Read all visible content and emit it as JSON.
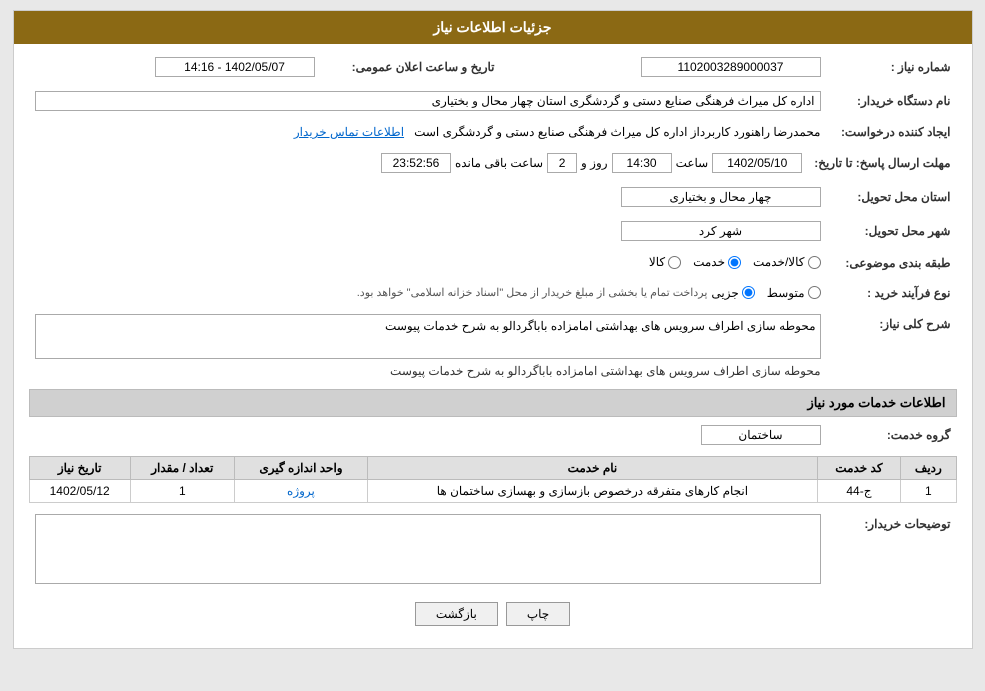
{
  "header": {
    "title": "جزئیات اطلاعات نیاز"
  },
  "fields": {
    "need_number_label": "شماره نیاز :",
    "need_number_value": "1102003289000037",
    "date_label": "تاریخ و ساعت اعلان عمومی:",
    "date_value": "1402/05/07 - 14:16",
    "buyer_org_label": "نام دستگاه خریدار:",
    "buyer_org_value": "اداره کل میراث فرهنگی  صنایع دستی و گردشگری استان چهار محال و بختیاری",
    "creator_label": "ایجاد کننده درخواست:",
    "creator_value": "محمدرضا راهنورد کاربرداز اداره کل میراث فرهنگی  صنایع دستی و گردشگری است",
    "creator_link": "اطلاعات تماس خریدار",
    "response_deadline_label": "مهلت ارسال پاسخ: تا تاریخ:",
    "response_date": "1402/05/10",
    "response_time_label": "ساعت",
    "response_time": "14:30",
    "response_days_label": "روز و",
    "response_days": "2",
    "response_remaining_label": "ساعت باقی مانده",
    "response_remaining": "23:52:56",
    "province_label": "استان محل تحویل:",
    "province_value": "چهار محال و بختیاری",
    "city_label": "شهر محل تحویل:",
    "city_value": "شهر کرد",
    "category_label": "طبقه بندی موضوعی:",
    "category_options": [
      "کالا",
      "خدمت",
      "کالا/خدمت"
    ],
    "category_selected": "خدمت",
    "purchase_type_label": "نوع فرآیند خرید :",
    "purchase_type_options": [
      "جزیی",
      "متوسط"
    ],
    "purchase_type_note": "پرداخت تمام یا بخشی از مبلغ خریدار از محل \"اسناد خزانه اسلامی\" خواهد بود.",
    "need_description_label": "شرح کلی نیاز:",
    "need_description_value": "محوطه سازی اطراف سرویس های بهداشتی امامزاده باباگردالو به شرح خدمات پیوست",
    "services_section_label": "اطلاعات خدمات مورد نیاز",
    "service_group_label": "گروه خدمت:",
    "service_group_value": "ساختمان",
    "table": {
      "headers": [
        "ردیف",
        "کد خدمت",
        "نام خدمت",
        "واحد اندازه گیری",
        "تعداد / مقدار",
        "تاریخ نیاز"
      ],
      "rows": [
        {
          "row_num": "1",
          "service_code": "ج-44",
          "service_name": "انجام کارهای متفرقه درخصوص بازسازی و بهسازی ساختمان ها",
          "unit": "پروژه",
          "quantity": "1",
          "date": "1402/05/12"
        }
      ]
    },
    "buyer_notes_label": "توضیحات خریدار:",
    "buyer_notes_value": "",
    "back_button": "بازگشت",
    "print_button": "چاپ"
  }
}
